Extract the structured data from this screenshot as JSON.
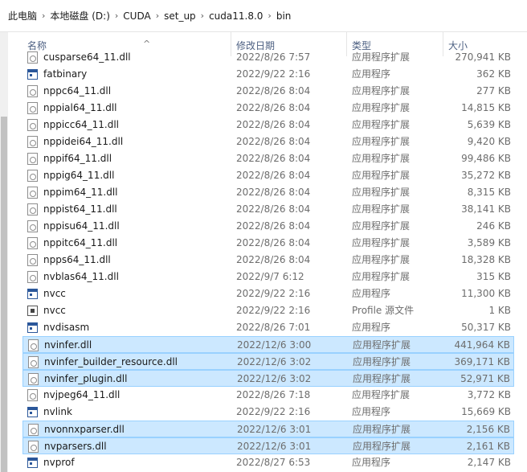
{
  "breadcrumb": [
    "此电脑",
    "本地磁盘 (D:)",
    "CUDA",
    "set_up",
    "cuda11.8.0",
    "bin"
  ],
  "columns": {
    "name": "名称",
    "date": "修改日期",
    "type": "类型",
    "size": "大小"
  },
  "files": [
    {
      "name": "cusparse64_11.dll",
      "date": "2022/8/26 7:57",
      "type": "应用程序扩展",
      "size": "270,941 KB",
      "icon": "dll-file-icon",
      "selected": false
    },
    {
      "name": "fatbinary",
      "date": "2022/9/22 2:16",
      "type": "应用程序",
      "size": "362 KB",
      "icon": "exe-file-icon",
      "selected": false
    },
    {
      "name": "nppc64_11.dll",
      "date": "2022/8/26 8:04",
      "type": "应用程序扩展",
      "size": "277 KB",
      "icon": "dll-file-icon",
      "selected": false
    },
    {
      "name": "nppial64_11.dll",
      "date": "2022/8/26 8:04",
      "type": "应用程序扩展",
      "size": "14,815 KB",
      "icon": "dll-file-icon",
      "selected": false
    },
    {
      "name": "nppicc64_11.dll",
      "date": "2022/8/26 8:04",
      "type": "应用程序扩展",
      "size": "5,639 KB",
      "icon": "dll-file-icon",
      "selected": false
    },
    {
      "name": "nppidei64_11.dll",
      "date": "2022/8/26 8:04",
      "type": "应用程序扩展",
      "size": "9,420 KB",
      "icon": "dll-file-icon",
      "selected": false
    },
    {
      "name": "nppif64_11.dll",
      "date": "2022/8/26 8:04",
      "type": "应用程序扩展",
      "size": "99,486 KB",
      "icon": "dll-file-icon",
      "selected": false
    },
    {
      "name": "nppig64_11.dll",
      "date": "2022/8/26 8:04",
      "type": "应用程序扩展",
      "size": "35,272 KB",
      "icon": "dll-file-icon",
      "selected": false
    },
    {
      "name": "nppim64_11.dll",
      "date": "2022/8/26 8:04",
      "type": "应用程序扩展",
      "size": "8,315 KB",
      "icon": "dll-file-icon",
      "selected": false
    },
    {
      "name": "nppist64_11.dll",
      "date": "2022/8/26 8:04",
      "type": "应用程序扩展",
      "size": "38,141 KB",
      "icon": "dll-file-icon",
      "selected": false
    },
    {
      "name": "nppisu64_11.dll",
      "date": "2022/8/26 8:04",
      "type": "应用程序扩展",
      "size": "246 KB",
      "icon": "dll-file-icon",
      "selected": false
    },
    {
      "name": "nppitc64_11.dll",
      "date": "2022/8/26 8:04",
      "type": "应用程序扩展",
      "size": "3,589 KB",
      "icon": "dll-file-icon",
      "selected": false
    },
    {
      "name": "npps64_11.dll",
      "date": "2022/8/26 8:04",
      "type": "应用程序扩展",
      "size": "18,328 KB",
      "icon": "dll-file-icon",
      "selected": false
    },
    {
      "name": "nvblas64_11.dll",
      "date": "2022/9/7 6:12",
      "type": "应用程序扩展",
      "size": "315 KB",
      "icon": "dll-file-icon",
      "selected": false
    },
    {
      "name": "nvcc",
      "date": "2022/9/22 2:16",
      "type": "应用程序",
      "size": "11,300 KB",
      "icon": "exe-file-icon",
      "selected": false
    },
    {
      "name": "nvcc",
      "date": "2022/9/22 2:16",
      "type": "Profile 源文件",
      "size": "1 KB",
      "icon": "profile-file-icon",
      "selected": false
    },
    {
      "name": "nvdisasm",
      "date": "2022/8/26 7:01",
      "type": "应用程序",
      "size": "50,317 KB",
      "icon": "exe-file-icon",
      "selected": false
    },
    {
      "name": "nvinfer.dll",
      "date": "2022/12/6 3:00",
      "type": "应用程序扩展",
      "size": "441,964 KB",
      "icon": "dll-file-icon",
      "selected": true
    },
    {
      "name": "nvinfer_builder_resource.dll",
      "date": "2022/12/6 3:02",
      "type": "应用程序扩展",
      "size": "369,171 KB",
      "icon": "dll-file-icon",
      "selected": true
    },
    {
      "name": "nvinfer_plugin.dll",
      "date": "2022/12/6 3:02",
      "type": "应用程序扩展",
      "size": "52,971 KB",
      "icon": "dll-file-icon",
      "selected": true
    },
    {
      "name": "nvjpeg64_11.dll",
      "date": "2022/8/26 7:18",
      "type": "应用程序扩展",
      "size": "3,772 KB",
      "icon": "dll-file-icon",
      "selected": false
    },
    {
      "name": "nvlink",
      "date": "2022/9/22 2:16",
      "type": "应用程序",
      "size": "15,669 KB",
      "icon": "exe-file-icon",
      "selected": false
    },
    {
      "name": "nvonnxparser.dll",
      "date": "2022/12/6 3:01",
      "type": "应用程序扩展",
      "size": "2,156 KB",
      "icon": "dll-file-icon",
      "selected": true
    },
    {
      "name": "nvparsers.dll",
      "date": "2022/12/6 3:01",
      "type": "应用程序扩展",
      "size": "2,161 KB",
      "icon": "dll-file-icon",
      "selected": true
    },
    {
      "name": "nvprof",
      "date": "2022/8/27 6:53",
      "type": "应用程序",
      "size": "2,147 KB",
      "icon": "exe-file-icon",
      "selected": false
    }
  ]
}
